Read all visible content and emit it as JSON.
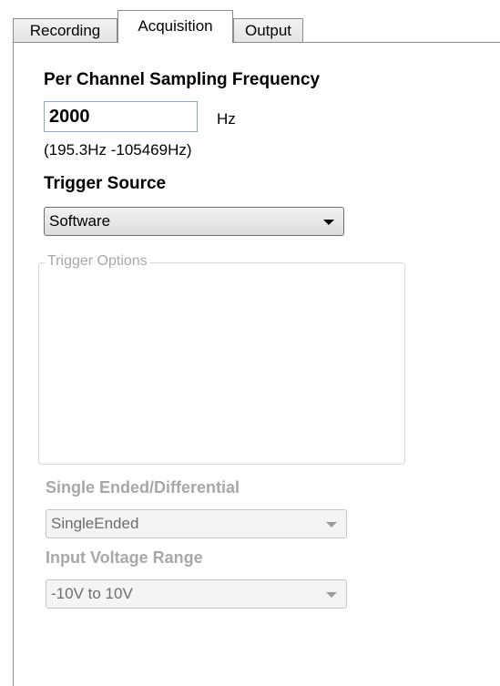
{
  "tabs": [
    {
      "label": "Recording",
      "active": false
    },
    {
      "label": "Acquisition",
      "active": true
    },
    {
      "label": "Output",
      "active": false
    }
  ],
  "sampling": {
    "heading": "Per Channel Sampling Frequency",
    "value": "2000",
    "unit": "Hz",
    "range": "(195.3Hz -105469Hz)"
  },
  "trigger": {
    "heading": "Trigger Source",
    "selected": "Software",
    "options_group_label": "Trigger Options"
  },
  "input_mode": {
    "heading": "Single Ended/Differential",
    "selected": "SingleEnded"
  },
  "voltage": {
    "heading": "Input Voltage Range",
    "selected": "-10V to 10V"
  },
  "colors": {
    "tab_border": "#8c8c8c",
    "disabled_text": "#a8a8a8",
    "input_border": "#8aa6c8"
  }
}
